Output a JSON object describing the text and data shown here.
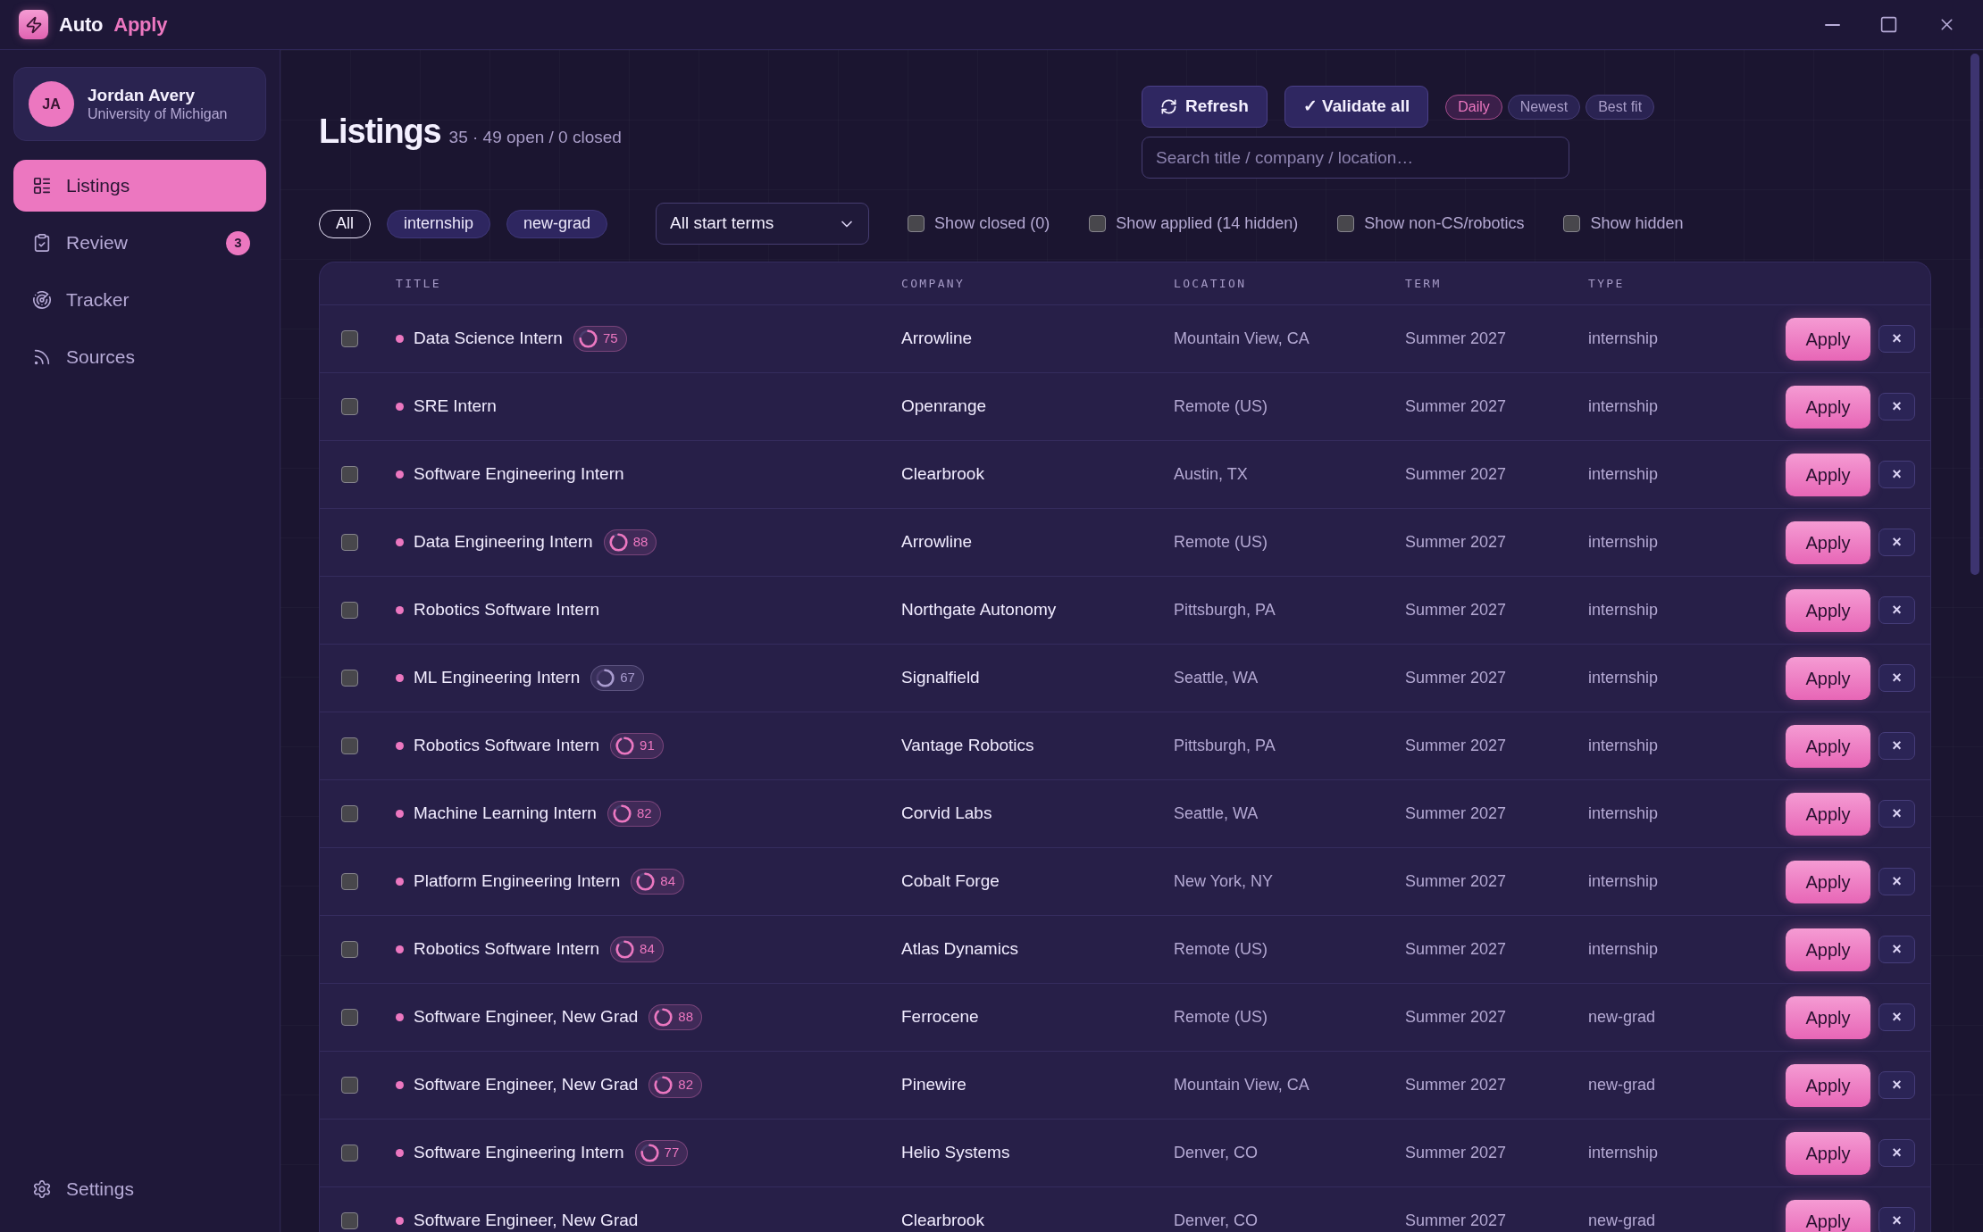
{
  "title_bar": {
    "brand": "Auto",
    "brand_accent": "Apply"
  },
  "sidebar": {
    "profile": {
      "initials": "JA",
      "name": "Jordan Avery",
      "school": "University of Michigan"
    },
    "nav": [
      {
        "label": "Listings",
        "selected": true
      },
      {
        "label": "Review",
        "selected": false,
        "badge": "3"
      },
      {
        "label": "Tracker",
        "selected": false
      },
      {
        "label": "Sources",
        "selected": false
      }
    ],
    "footer": {
      "label": "Settings"
    }
  },
  "header": {
    "title": "Listings",
    "summary": "35 · 49 open / 0 closed",
    "actions": [
      {
        "kind": "refresh",
        "label": "Refresh"
      },
      {
        "kind": "validate",
        "label": "✓ Validate all"
      }
    ],
    "sort": [
      {
        "label": "Daily",
        "selected": true
      },
      {
        "label": "Newest",
        "selected": false
      },
      {
        "label": "Best fit",
        "selected": false
      }
    ],
    "search": {
      "placeholder": "Search title / company / location…"
    }
  },
  "filters": {
    "types": [
      {
        "label": "All",
        "selected": true
      },
      {
        "label": "internship",
        "selected": false
      },
      {
        "label": "new-grad",
        "selected": false
      }
    ],
    "term": "All start terms",
    "toggles": [
      {
        "label": "Show closed (0)",
        "checked": false
      },
      {
        "label": "Show applied (14 hidden)",
        "checked": false
      },
      {
        "label": "Show non-CS/robotics",
        "checked": false
      },
      {
        "label": "Show hidden",
        "checked": false
      }
    ]
  },
  "table": {
    "columns": [
      "TITLE",
      "COMPANY",
      "LOCATION",
      "TERM",
      "TYPE"
    ],
    "rows": [
      {
        "checked": false,
        "title": {
          "text": "Data Science Intern",
          "score": {
            "value": "75",
            "color": "#ec77c0"
          }
        },
        "company": "Arrowline",
        "location": "Mountain View, CA",
        "term": "Summer 2027",
        "type": "internship",
        "action": "Apply",
        "dismiss": "×"
      },
      {
        "checked": false,
        "title": {
          "text": "SRE Intern"
        },
        "company": "Openrange",
        "location": "Remote (US)",
        "term": "Summer 2027",
        "type": "internship",
        "action": "Apply",
        "dismiss": "×"
      },
      {
        "checked": false,
        "title": {
          "text": "Software Engineering Intern"
        },
        "company": "Clearbrook",
        "location": "Austin, TX",
        "term": "Summer 2027",
        "type": "internship",
        "action": "Apply",
        "dismiss": "×"
      },
      {
        "checked": false,
        "title": {
          "text": "Data Engineering Intern",
          "score": {
            "value": "88",
            "color": "#ec77c0"
          }
        },
        "company": "Arrowline",
        "location": "Remote (US)",
        "term": "Summer 2027",
        "type": "internship",
        "action": "Apply",
        "dismiss": "×"
      },
      {
        "checked": false,
        "title": {
          "text": "Robotics Software Intern"
        },
        "company": "Northgate Autonomy",
        "location": "Pittsburgh, PA",
        "term": "Summer 2027",
        "type": "internship",
        "action": "Apply",
        "dismiss": "×"
      },
      {
        "checked": false,
        "title": {
          "text": "ML Engineering Intern",
          "score": {
            "value": "67",
            "color": "#a99ccf"
          }
        },
        "company": "Signalfield",
        "location": "Seattle, WA",
        "term": "Summer 2027",
        "type": "internship",
        "action": "Apply",
        "dismiss": "×"
      },
      {
        "checked": false,
        "title": {
          "text": "Robotics Software Intern",
          "score": {
            "value": "91",
            "color": "#ec77c0"
          }
        },
        "company": "Vantage Robotics",
        "location": "Pittsburgh, PA",
        "term": "Summer 2027",
        "type": "internship",
        "action": "Apply",
        "dismiss": "×"
      },
      {
        "checked": false,
        "title": {
          "text": "Machine Learning Intern",
          "score": {
            "value": "82",
            "color": "#ec77c0"
          }
        },
        "company": "Corvid Labs",
        "location": "Seattle, WA",
        "term": "Summer 2027",
        "type": "internship",
        "action": "Apply",
        "dismiss": "×"
      },
      {
        "checked": false,
        "title": {
          "text": "Platform Engineering Intern",
          "score": {
            "value": "84",
            "color": "#ec77c0"
          }
        },
        "company": "Cobalt Forge",
        "location": "New York, NY",
        "term": "Summer 2027",
        "type": "internship",
        "action": "Apply",
        "dismiss": "×"
      },
      {
        "checked": false,
        "title": {
          "text": "Robotics Software Intern",
          "score": {
            "value": "84",
            "color": "#ec77c0"
          }
        },
        "company": "Atlas Dynamics",
        "location": "Remote (US)",
        "term": "Summer 2027",
        "type": "internship",
        "action": "Apply",
        "dismiss": "×"
      },
      {
        "checked": false,
        "title": {
          "text": "Software Engineer, New Grad",
          "score": {
            "value": "88",
            "color": "#ec77c0"
          }
        },
        "company": "Ferrocene",
        "location": "Remote (US)",
        "term": "Summer 2027",
        "type": "new-grad",
        "action": "Apply",
        "dismiss": "×"
      },
      {
        "checked": false,
        "title": {
          "text": "Software Engineer, New Grad",
          "score": {
            "value": "82",
            "color": "#ec77c0"
          }
        },
        "company": "Pinewire",
        "location": "Mountain View, CA",
        "term": "Summer 2027",
        "type": "new-grad",
        "action": "Apply",
        "dismiss": "×"
      },
      {
        "checked": false,
        "title": {
          "text": "Software Engineering Intern",
          "score": {
            "value": "77",
            "color": "#ec77c0"
          }
        },
        "company": "Helio Systems",
        "location": "Denver, CO",
        "term": "Summer 2027",
        "type": "internship",
        "action": "Apply",
        "dismiss": "×"
      },
      {
        "checked": false,
        "title": {
          "text": "Software Engineer, New Grad"
        },
        "company": "Clearbrook",
        "location": "Denver, CO",
        "term": "Summer 2027",
        "type": "new-grad",
        "action": "Apply",
        "dismiss": "×"
      }
    ]
  }
}
